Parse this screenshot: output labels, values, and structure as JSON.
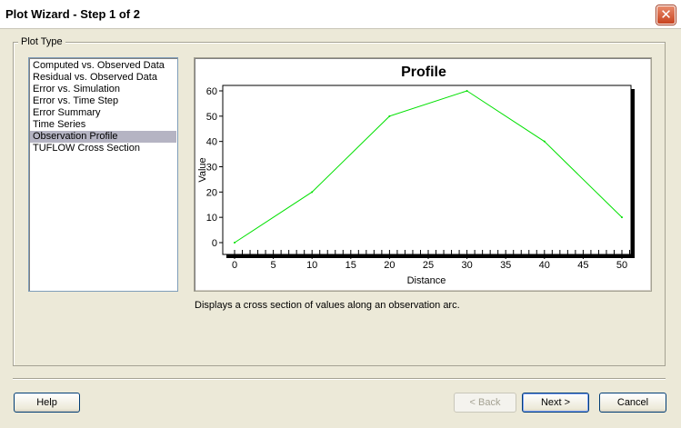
{
  "window": {
    "title": "Plot Wizard - Step 1 of 2",
    "close_glyph": "✕"
  },
  "group": {
    "label": "Plot Type"
  },
  "plot_types": [
    {
      "label": "Computed vs. Observed Data",
      "selected": false
    },
    {
      "label": "Residual vs. Observed Data",
      "selected": false
    },
    {
      "label": "Error vs. Simulation",
      "selected": false
    },
    {
      "label": "Error vs. Time Step",
      "selected": false
    },
    {
      "label": "Error Summary",
      "selected": false
    },
    {
      "label": "Time Series",
      "selected": false
    },
    {
      "label": "Observation Profile",
      "selected": true
    },
    {
      "label": "TUFLOW Cross Section",
      "selected": false
    }
  ],
  "description": "Displays a cross section of values along an observation arc.",
  "buttons": {
    "help": "Help",
    "back": "< Back",
    "next": "Next >",
    "cancel": "Cancel"
  },
  "chart_data": {
    "type": "line",
    "title": "Profile",
    "xlabel": "Distance",
    "ylabel": "Value",
    "xlim": [
      0,
      53
    ],
    "ylim": [
      0,
      65
    ],
    "x_ticks": [
      0,
      5,
      10,
      15,
      20,
      25,
      30,
      35,
      40,
      45,
      50
    ],
    "y_ticks": [
      0,
      10,
      20,
      30,
      40,
      50,
      60
    ],
    "x_minor_step": 1,
    "grid": false,
    "legend": "none",
    "series": [
      {
        "color": "#00e000",
        "x": [
          0,
          10,
          20,
          30,
          40,
          50
        ],
        "y": [
          0,
          20,
          50,
          60,
          40,
          10
        ]
      }
    ]
  }
}
